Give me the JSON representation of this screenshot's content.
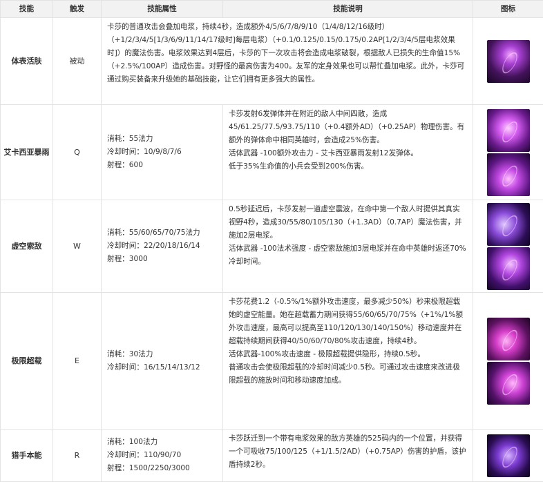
{
  "header": {
    "col_skill": "技能",
    "col_trigger": "触发",
    "col_attr": "技能属性",
    "col_desc": "技能说明",
    "col_icon": "图标"
  },
  "passive": {
    "name": "体表活肤",
    "trigger": "被动",
    "desc": "卡莎的普通攻击会叠加电浆，持续4秒，造成额外4/5/6/7/8/9/10（1/4/8/12/16级时）（+1/2/3/4/5[1/3/6/9/11/14/17级时]每层电浆）（+0.1/0.125/0.15/0.175/0.2AP[1/2/3/4/5层电浆效果时]）的魔法伤害。电浆效果达到4层后，卡莎的下一次攻击将会造成电浆破裂，根据敌人已损失的生命值15%（+2.5%/100AP）造成伤害。对野怪的最高伤害为400。友军的定身效果也可以帮忙叠加电浆。此外，卡莎可通过购买装备来升级她的基础技能，让它们拥有更多强大的属性。",
    "icon": "kaisa-passive-icon"
  },
  "q": {
    "name": "艾卡西亚暴雨",
    "trigger": "Q",
    "attr": [
      "消耗：55法力",
      "冷却时间：10/9/8/7/6",
      "射程：600"
    ],
    "desc": [
      "卡莎发射6发弹体并在附近的敌人中间四散，造成45/61.25/77.5/93.75/110（+0.4额外AD）（+0.25AP）物理伤害。有额外的弹体命中相同英雄时，会造成25%伤害。",
      "活体武器 -100额外攻击力 - 艾卡西亚暴雨发射12发弹体。",
      "低于35%生命值的小兵会受到200%伤害。"
    ],
    "icons": [
      "icathian-rain-icon",
      "icathian-rain-evolved-icon"
    ]
  },
  "w": {
    "name": "虚空索敌",
    "trigger": "W",
    "attr": [
      "消耗：55/60/65/70/75法力",
      "冷却时间：22/20/18/16/14",
      "射程：3000"
    ],
    "desc": [
      "0.5秒延迟后，卡莎发射一道虚空震波，在命中第一个敌人时提供其真实视野4秒，造成30/55/80/105/130（+1.3AD）（0.7AP）魔法伤害，并施加2层电浆。",
      "活体武器 -100法术强度 - 虚空索敌施加3层电浆并在命中英雄时返还70%冷却时间。"
    ],
    "icons": [
      "void-seeker-icon",
      "void-seeker-evolved-icon"
    ]
  },
  "e": {
    "name": "极限超载",
    "trigger": "E",
    "attr": [
      "消耗：30法力",
      "冷却时间：16/15/14/13/12"
    ],
    "desc": [
      "卡莎花费1.2（-0.5%/1%额外攻击速度，最多减少50%）秒来极限超载她的虚空能量。她在超载蓄力期间获得55/60/65/70/75%（+1%/1%额外攻击速度，最高可以提高至110/120/130/140/150%）移动速度并在超载持续期间获得40/50/60/70/80%攻击速度，持续4秒。",
      "活体武器-100%攻击速度 - 极限超载提供隐形，持续0.5秒。",
      "普通攻击会使极限超载的冷却时间减少0.5秒。可通过攻击速度来改进极限超载的施放时间和移动速度加成。"
    ],
    "icons": [
      "supercharge-icon",
      "supercharge-evolved-icon"
    ]
  },
  "r": {
    "name": "猎手本能",
    "trigger": "R",
    "attr": [
      "消耗：100法力",
      "冷却时间：110/90/70",
      "射程：1500/2250/3000"
    ],
    "desc": "卡莎跃迁到一个带有电浆效果的敌方英雄的525码内的一个位置，并获得一个可吸收75/100/125（+1/1.5/2AD）（+0.75AP）伤害的护盾，该护盾持续2秒。",
    "icon": "killer-instinct-icon"
  }
}
